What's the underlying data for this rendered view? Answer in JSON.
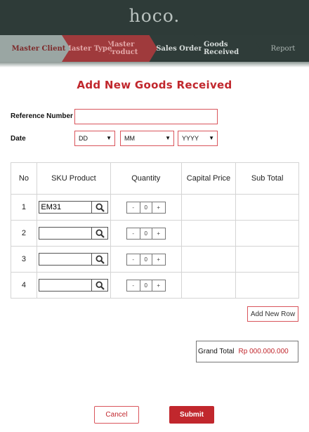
{
  "brand": {
    "logo": "hoco."
  },
  "steps": [
    {
      "label": "Master Client"
    },
    {
      "label": "Master Type"
    },
    {
      "label": "Master Product"
    },
    {
      "label": "Sales Order"
    },
    {
      "label": "Goods Received"
    },
    {
      "label": "Report"
    }
  ],
  "form": {
    "title": "Add New Goods Received",
    "reference_label": "Reference Number",
    "reference_value": "",
    "date_label": "Date",
    "day_value": "DD",
    "month_value": "MM",
    "year_value": "YYYY"
  },
  "table": {
    "headers": [
      "No",
      "SKU Product",
      "Quantity",
      "Capital Price",
      "Sub Total"
    ],
    "rows": [
      {
        "no": "1",
        "sku": "EM31",
        "qty": "0",
        "minus": "-",
        "plus": "+",
        "capital": "",
        "subtotal": ""
      },
      {
        "no": "2",
        "sku": "",
        "qty": "0",
        "minus": "-",
        "plus": "+",
        "capital": "",
        "subtotal": ""
      },
      {
        "no": "3",
        "sku": "",
        "qty": "0",
        "minus": "-",
        "plus": "+",
        "capital": "",
        "subtotal": ""
      },
      {
        "no": "4",
        "sku": "",
        "qty": "0",
        "minus": "-",
        "plus": "+",
        "capital": "",
        "subtotal": ""
      }
    ]
  },
  "actions": {
    "add_row": "Add New Row",
    "grand_total_label": "Grand Total",
    "grand_total_value": "Rp 000.000.000",
    "cancel": "Cancel",
    "submit": "Submit"
  },
  "icons": {
    "search": "search-icon",
    "dropdown": "chevron-down-icon"
  },
  "colors": {
    "accent": "#c1272d",
    "header_bg": "#2e3b38",
    "step_active": "#9f3a3c",
    "step_done": "#9aa6a3"
  }
}
